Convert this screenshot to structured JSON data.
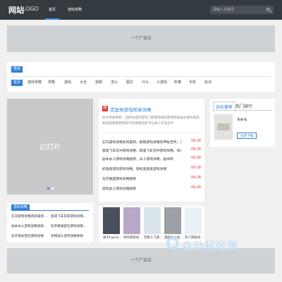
{
  "header": {
    "logo_main": "网站",
    "logo_sub": "LOGO",
    "nav": [
      "首页",
      "游戏攻略"
    ],
    "search_placeholder": "请输入关键词"
  },
  "ads": {
    "top": "一个广告位",
    "bottom": "一个广告位"
  },
  "tags": {
    "heading": "类目",
    "active": "首页",
    "items": [
      "游戏攻略",
      "攻略",
      "游戏",
      "大全",
      "视频",
      "怎么",
      "图文",
      "什么",
      "小游戏",
      "阶格",
      "手机",
      "玩法"
    ]
  },
  "slider": {
    "label": "幻灯片"
  },
  "guides": {
    "heading": "游戏攻略",
    "items": [
      "实况游戏攻略系统漏洞...",
      "极速飞车花单游戏攻略...",
      "副本永斗游戏攻略视频...",
      "双开模凝冒险游戏攻略...",
      "双开我省冒险游戏攻略",
      "怨物战斗游戏攻略视频",
      "",
      ""
    ]
  },
  "hot": {
    "icon": "荐",
    "title": "完室类游戏简单攻略",
    "desc": "本文目录导航：选择合适的游戏了解游戏规则和目标准备必要的道具和技能掌握游戏技巧和策略多练习与他人交流合作",
    "rows": [
      {
        "title": "实况游戏攻略系统漏洞，解锁游戏攻略的神秘世界，实况游戏",
        "date": "09-28"
      },
      {
        "title": "极速飞车花冲游戏攻略，极速飞车花冲游戏攻略，快速通关技",
        "date": "09-28"
      },
      {
        "title": "副本永斗游戏攻略视频，永斗游戏攻略，副本制",
        "date": "09-28"
      },
      {
        "title": "抓鬼类冒险游戏攻略，轻松驱鬼类游戏攻略",
        "date": "09-28"
      },
      {
        "title": "双开独盟游戏攻略视频",
        "date": "09-28"
      },
      {
        "title": "冒险战斗游戏攻略视频",
        "date": "09-28"
      }
    ]
  },
  "thumbs": {
    "captions": [
      "关于hypno...",
      "译的游戏攻...",
      "完善斗飞游...",
      "漫画战斗式...",
      "年少游戏攻..."
    ],
    "colors": [
      "#4a4f5c",
      "#b9a7c8",
      "#d8e4ea",
      "#9aa0a6",
      "#eaf1f4"
    ]
  },
  "ranking": {
    "tabs": [
      "站长推荐",
      "热门排行"
    ],
    "item_name": "未命名",
    "button": "立即下载"
  },
  "watermark": {
    "brand": "自动秘收录",
    "sub": "一 点击链接 一 来访一次 一 自动收录 一"
  },
  "colors": {
    "accent": "#2f7fd9",
    "date": "#e03131",
    "topbar": "#333a40"
  }
}
